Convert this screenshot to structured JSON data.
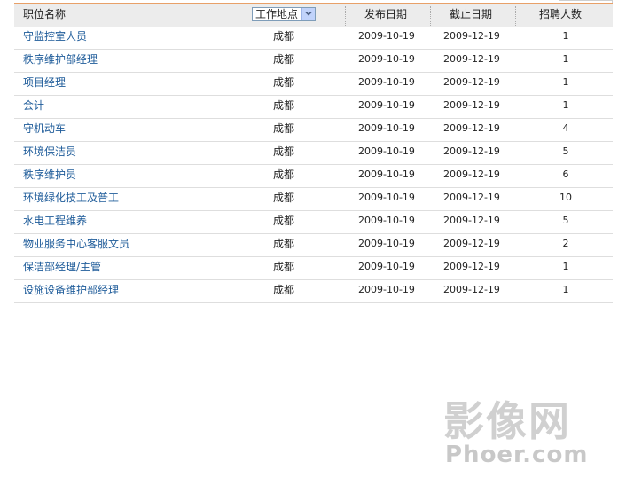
{
  "header": {
    "col_name": "职位名称",
    "col_location_select": "工作地点",
    "col_publish": "发布日期",
    "col_deadline": "截止日期",
    "col_count": "招聘人数"
  },
  "rows": [
    {
      "name": "守监控室人员",
      "location": "成都",
      "publish": "2009-10-19",
      "deadline": "2009-12-19",
      "count": "1"
    },
    {
      "name": "秩序维护部经理",
      "location": "成都",
      "publish": "2009-10-19",
      "deadline": "2009-12-19",
      "count": "1"
    },
    {
      "name": "项目经理",
      "location": "成都",
      "publish": "2009-10-19",
      "deadline": "2009-12-19",
      "count": "1"
    },
    {
      "name": "会计",
      "location": "成都",
      "publish": "2009-10-19",
      "deadline": "2009-12-19",
      "count": "1"
    },
    {
      "name": "守机动车",
      "location": "成都",
      "publish": "2009-10-19",
      "deadline": "2009-12-19",
      "count": "4"
    },
    {
      "name": "环境保洁员",
      "location": "成都",
      "publish": "2009-10-19",
      "deadline": "2009-12-19",
      "count": "5"
    },
    {
      "name": "秩序维护员",
      "location": "成都",
      "publish": "2009-10-19",
      "deadline": "2009-12-19",
      "count": "6"
    },
    {
      "name": "环境绿化技工及普工",
      "location": "成都",
      "publish": "2009-10-19",
      "deadline": "2009-12-19",
      "count": "10"
    },
    {
      "name": "水电工程维养",
      "location": "成都",
      "publish": "2009-10-19",
      "deadline": "2009-12-19",
      "count": "5"
    },
    {
      "name": "物业服务中心客服文员",
      "location": "成都",
      "publish": "2009-10-19",
      "deadline": "2009-12-19",
      "count": "2"
    },
    {
      "name": "保洁部经理/主管",
      "location": "成都",
      "publish": "2009-10-19",
      "deadline": "2009-12-19",
      "count": "1"
    },
    {
      "name": "设施设备维护部经理",
      "location": "成都",
      "publish": "2009-10-19",
      "deadline": "2009-12-19",
      "count": "1"
    }
  ],
  "watermark": {
    "text_cn": "影像网",
    "text_en": "Phoer.com"
  },
  "colors": {
    "accent_line": "#e8a068",
    "link": "#1f5c9a",
    "header_bg": "#ececec"
  }
}
